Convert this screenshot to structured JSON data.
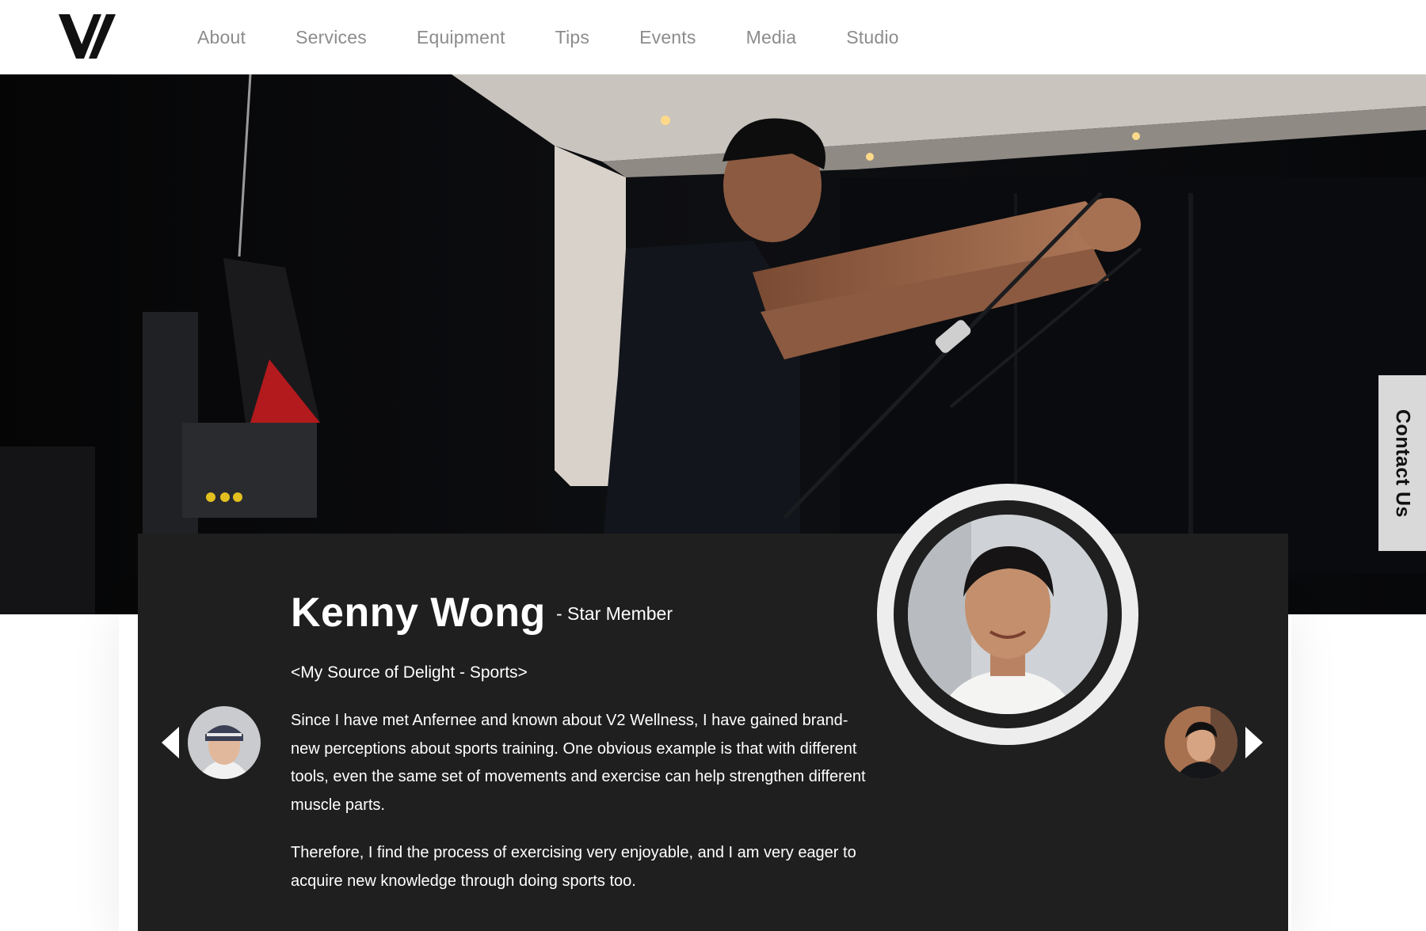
{
  "brand": {
    "logo_icon": "v2-logo-icon"
  },
  "nav": {
    "items": [
      {
        "label": "About"
      },
      {
        "label": "Services"
      },
      {
        "label": "Equipment"
      },
      {
        "label": "Tips"
      },
      {
        "label": "Events"
      },
      {
        "label": "Media"
      },
      {
        "label": "Studio"
      }
    ]
  },
  "hero": {
    "image": "trainer-cable-workout-photo"
  },
  "contact_tab": {
    "label": "Contact Us"
  },
  "testimonial": {
    "name": "Kenny Wong",
    "role": "- Star Member",
    "subtitle": "<My Source of Delight - Sports>",
    "paragraphs": [
      "Since I have met Anfernee and known about V2 Wellness, I have gained brand-new perceptions about sports training. One obvious example is that with different tools, even the same set of movements and exercise can help strengthen different muscle parts.",
      "Therefore, I find the process of exercising very enjoyable, and I am very eager to acquire new knowledge through doing sports too."
    ],
    "portrait": "member-portrait-photo",
    "prev_thumb": "previous-member-avatar",
    "next_thumb": "next-member-avatar"
  },
  "colors": {
    "nav_text": "#8c8c8c",
    "card_bg": "#1f1f1f",
    "ring": "#ededed",
    "contact_tab_bg": "#d9d9d9"
  }
}
